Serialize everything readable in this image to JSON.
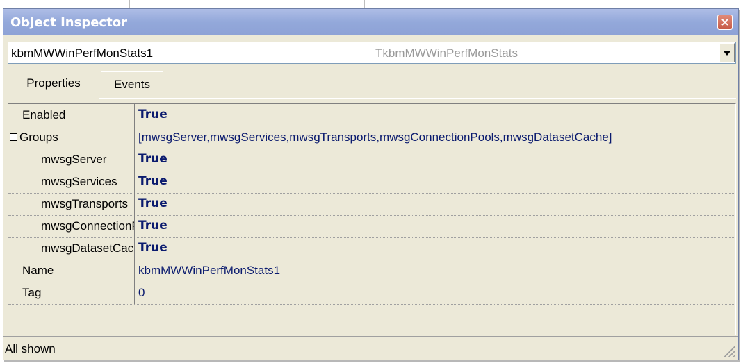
{
  "window": {
    "title": "Object Inspector",
    "close_glyph": "×"
  },
  "selector": {
    "object_name": "kbmMWWinPerfMonStats1",
    "object_type": "TkbmMWWinPerfMonStats"
  },
  "tabs": [
    {
      "label": "Properties",
      "active": true
    },
    {
      "label": "Events",
      "active": false
    }
  ],
  "properties": [
    {
      "name": "Enabled",
      "value": "True",
      "kind": "bool"
    },
    {
      "name": "Groups",
      "value": "[mwsgServer,mwsgServices,mwsgTransports,mwsgConnectionPools,mwsgDatasetCache]",
      "kind": "set",
      "expanded": true
    },
    {
      "name": "mwsgServer",
      "value": "True",
      "kind": "bool",
      "child": true
    },
    {
      "name": "mwsgServices",
      "value": "True",
      "kind": "bool",
      "child": true
    },
    {
      "name": "mwsgTransports",
      "value": "True",
      "kind": "bool",
      "child": true
    },
    {
      "name": "mwsgConnectionPools",
      "value": "True",
      "kind": "bool",
      "child": true
    },
    {
      "name": "mwsgDatasetCache",
      "value": "True",
      "kind": "bool",
      "child": true
    },
    {
      "name": "Name",
      "value": "kbmMWWinPerfMonStats1",
      "kind": "text"
    },
    {
      "name": "Tag",
      "value": "0",
      "kind": "text"
    }
  ],
  "status": {
    "text": "All shown"
  },
  "icons": {
    "close": "close-icon",
    "dropdown": "chevron-down-icon",
    "expander": "collapse-icon",
    "grip": "resize-grip-icon"
  },
  "colors": {
    "title_bar": "#93a8da",
    "value_text": "#0a1a6e",
    "face": "#ece9d8"
  }
}
